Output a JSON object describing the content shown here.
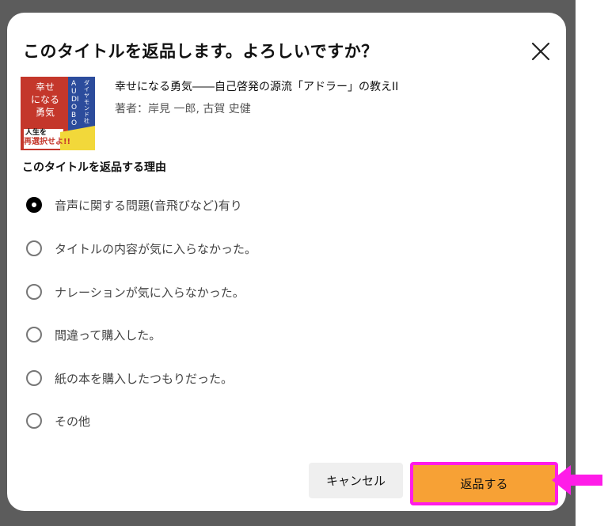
{
  "dialog": {
    "title": "このタイトルを返品します。よろしいですか？",
    "close_icon": "close-icon"
  },
  "book": {
    "title": "幸せになる勇気――自己啓発の源流「アドラー」の教えII",
    "author": "著者：岸見 一郎, 古賀 史健",
    "cover_text": {
      "main": [
        "幸せ",
        "になる",
        "勇気"
      ],
      "banner": "人生を",
      "banner2": "再選択せよ!!",
      "side": "AUDIO BO",
      "vertical": "ダイヤモンド社"
    }
  },
  "reasons": {
    "heading": "このタイトルを返品する理由",
    "items": [
      {
        "label": "音声に関する問題(音飛びなど)有り",
        "selected": true
      },
      {
        "label": "タイトルの内容が気に入らなかった。",
        "selected": false
      },
      {
        "label": "ナレーションが気に入らなかった。",
        "selected": false
      },
      {
        "label": "間違って購入した。",
        "selected": false
      },
      {
        "label": "紙の本を購入したつもりだった。",
        "selected": false
      },
      {
        "label": "その他",
        "selected": false
      }
    ]
  },
  "buttons": {
    "cancel": "キャンセル",
    "return": "返品する"
  },
  "colors": {
    "accent": "#f7a135",
    "highlight": "#ff1ce8",
    "backdrop": "#5c5c5c"
  }
}
